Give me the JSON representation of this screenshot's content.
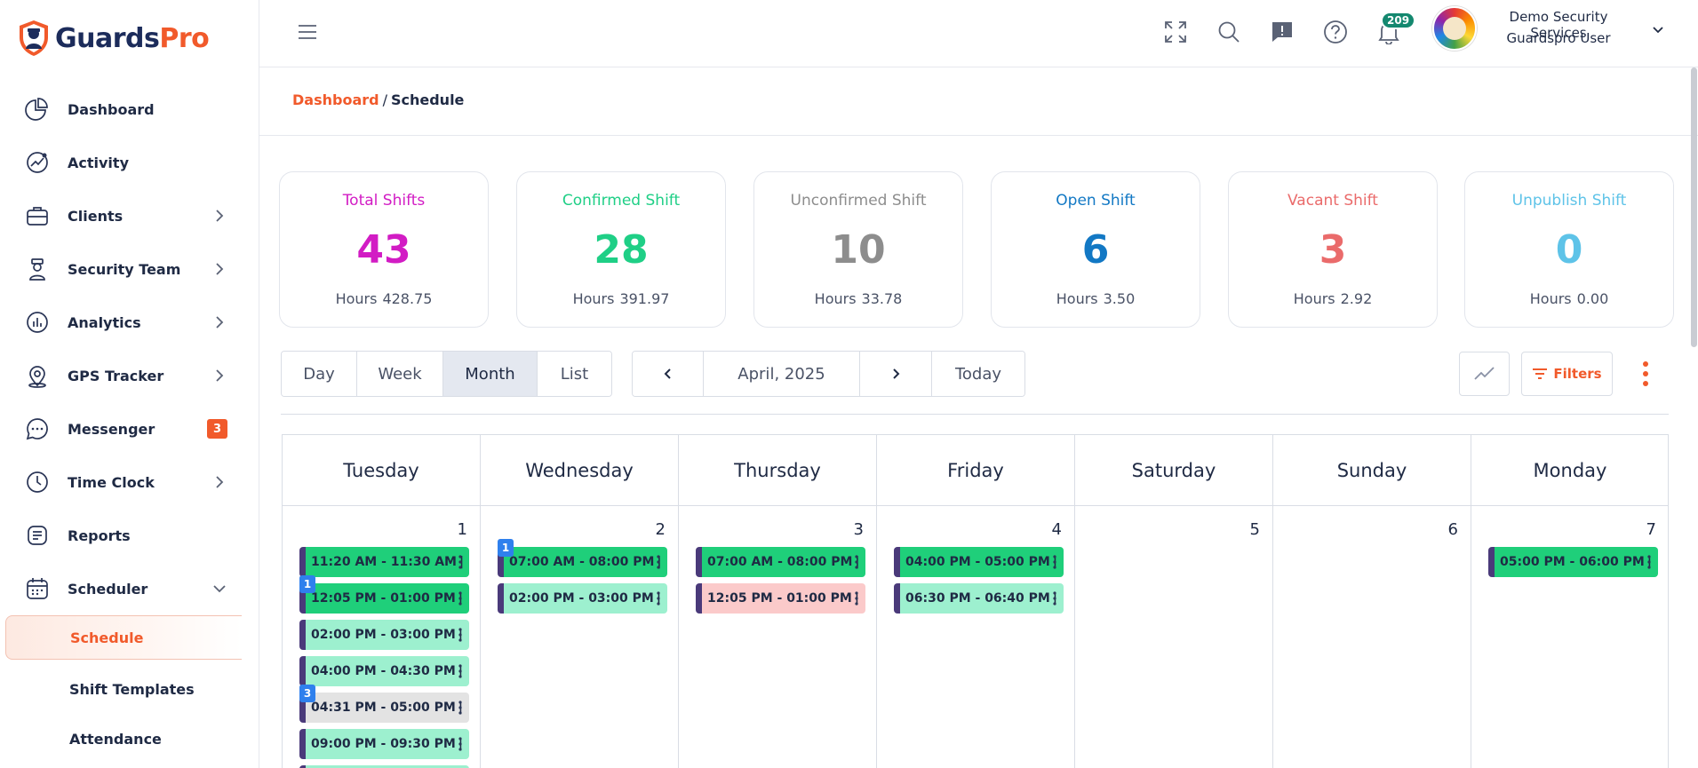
{
  "brand": {
    "logo_part1": "Guards",
    "logo_part2": "Pro"
  },
  "sidebar": {
    "items": [
      {
        "label": "Dashboard",
        "icon": "pie-chart-icon",
        "chevron": false
      },
      {
        "label": "Activity",
        "icon": "activity-icon",
        "chevron": false
      },
      {
        "label": "Clients",
        "icon": "briefcase-icon",
        "chevron": true
      },
      {
        "label": "Security Team",
        "icon": "guard-icon",
        "chevron": true
      },
      {
        "label": "Analytics",
        "icon": "bar-chart-icon",
        "chevron": true
      },
      {
        "label": "GPS Tracker",
        "icon": "map-pin-icon",
        "chevron": true
      },
      {
        "label": "Messenger",
        "icon": "chat-icon",
        "badge": "3"
      },
      {
        "label": "Time Clock",
        "icon": "clock-icon",
        "chevron": true
      },
      {
        "label": "Reports",
        "icon": "report-icon",
        "chevron": false
      },
      {
        "label": "Scheduler",
        "icon": "calendar-icon",
        "expanded": true
      }
    ],
    "subitems": [
      {
        "label": "Schedule",
        "active": true
      },
      {
        "label": "Shift Templates"
      },
      {
        "label": "Attendance"
      }
    ]
  },
  "topbar": {
    "notification_count": "209",
    "company": "Demo Security Services",
    "user_role": "Guardspro User"
  },
  "breadcrumb": {
    "parent": "Dashboard",
    "separator": "/",
    "current": "Schedule"
  },
  "stats": [
    {
      "title": "Total Shifts",
      "value": "43",
      "hours_label": "Hours",
      "hours": "428.75",
      "color": "#d21cc4"
    },
    {
      "title": "Confirmed Shift",
      "value": "28",
      "hours_label": "Hours",
      "hours": "391.97",
      "color": "#1fcf86"
    },
    {
      "title": "Unconfirmed Shift",
      "value": "10",
      "hours_label": "Hours",
      "hours": "33.78",
      "color": "#8d8d8d"
    },
    {
      "title": "Open Shift",
      "value": "6",
      "hours_label": "Hours",
      "hours": "3.50",
      "color": "#1278c4"
    },
    {
      "title": "Vacant Shift",
      "value": "3",
      "hours_label": "Hours",
      "hours": "2.92",
      "color": "#ea6b6b"
    },
    {
      "title": "Unpublish Shift",
      "value": "0",
      "hours_label": "Hours",
      "hours": "0.00",
      "color": "#5ec3e8"
    }
  ],
  "toolbar": {
    "views": [
      "Day",
      "Week",
      "Month",
      "List"
    ],
    "active_view": "Month",
    "period": "April, 2025",
    "today": "Today",
    "filters": "Filters"
  },
  "calendar": {
    "weekdays": [
      "Tuesday",
      "Wednesday",
      "Thursday",
      "Friday",
      "Saturday",
      "Sunday",
      "Monday"
    ],
    "days": [
      {
        "num": "1",
        "shifts": [
          {
            "time": "11:20 AM - 11:30 AM",
            "status": "confirmed"
          },
          {
            "time": "12:05 PM - 01:00 PM",
            "status": "confirmed",
            "count": "1"
          },
          {
            "time": "02:00 PM - 03:00 PM",
            "status": "open"
          },
          {
            "time": "04:00 PM - 04:30 PM",
            "status": "open"
          },
          {
            "time": "04:31 PM - 05:00 PM",
            "status": "unconfirmed",
            "count": "3"
          },
          {
            "time": "09:00 PM - 09:30 PM",
            "status": "open"
          },
          {
            "time": "",
            "status": "open"
          }
        ]
      },
      {
        "num": "2",
        "shifts": [
          {
            "time": "07:00 AM - 08:00 PM",
            "status": "confirmed",
            "count": "1"
          },
          {
            "time": "02:00 PM - 03:00 PM",
            "status": "open"
          }
        ]
      },
      {
        "num": "3",
        "shifts": [
          {
            "time": "07:00 AM - 08:00 PM",
            "status": "confirmed"
          },
          {
            "time": "12:05 PM - 01:00 PM",
            "status": "vacant"
          }
        ]
      },
      {
        "num": "4",
        "shifts": [
          {
            "time": "04:00 PM - 05:00 PM",
            "status": "confirmed"
          },
          {
            "time": "06:30 PM - 06:40 PM",
            "status": "open"
          }
        ]
      },
      {
        "num": "5",
        "shifts": []
      },
      {
        "num": "6",
        "shifts": []
      },
      {
        "num": "7",
        "shifts": [
          {
            "time": "05:00 PM - 06:00 PM",
            "status": "confirmed"
          }
        ]
      }
    ]
  },
  "shift_colors": {
    "confirmed": "#1fcf7a",
    "open": "#9df0cf",
    "unconfirmed": "#e3e3e3",
    "vacant": "#fbcaca"
  },
  "accent_color": "#f15a2b"
}
